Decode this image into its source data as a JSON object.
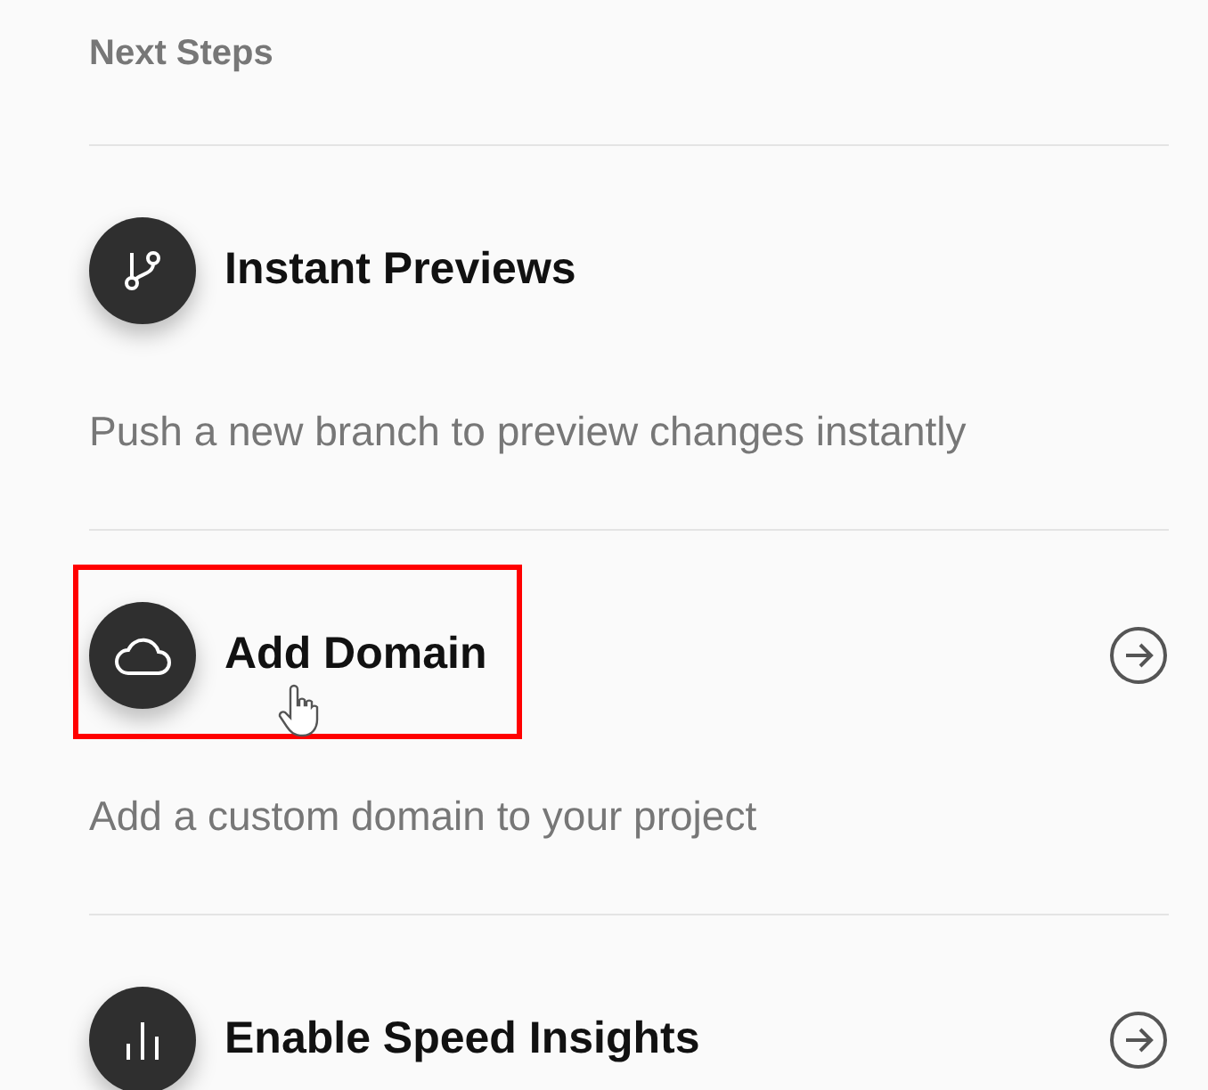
{
  "section": {
    "title": "Next Steps"
  },
  "steps": [
    {
      "kind": "branch",
      "title": "Instant Previews",
      "description": "Push a new branch to preview changes instantly",
      "arrow": false,
      "highlighted": false,
      "hovered": false
    },
    {
      "kind": "cloud",
      "title": "Add Domain",
      "description": "Add a custom domain to your project",
      "arrow": true,
      "highlighted": true,
      "hovered": true
    },
    {
      "kind": "chart",
      "title": "Enable Speed Insights",
      "arrow": true,
      "highlighted": false,
      "hovered": false
    }
  ]
}
